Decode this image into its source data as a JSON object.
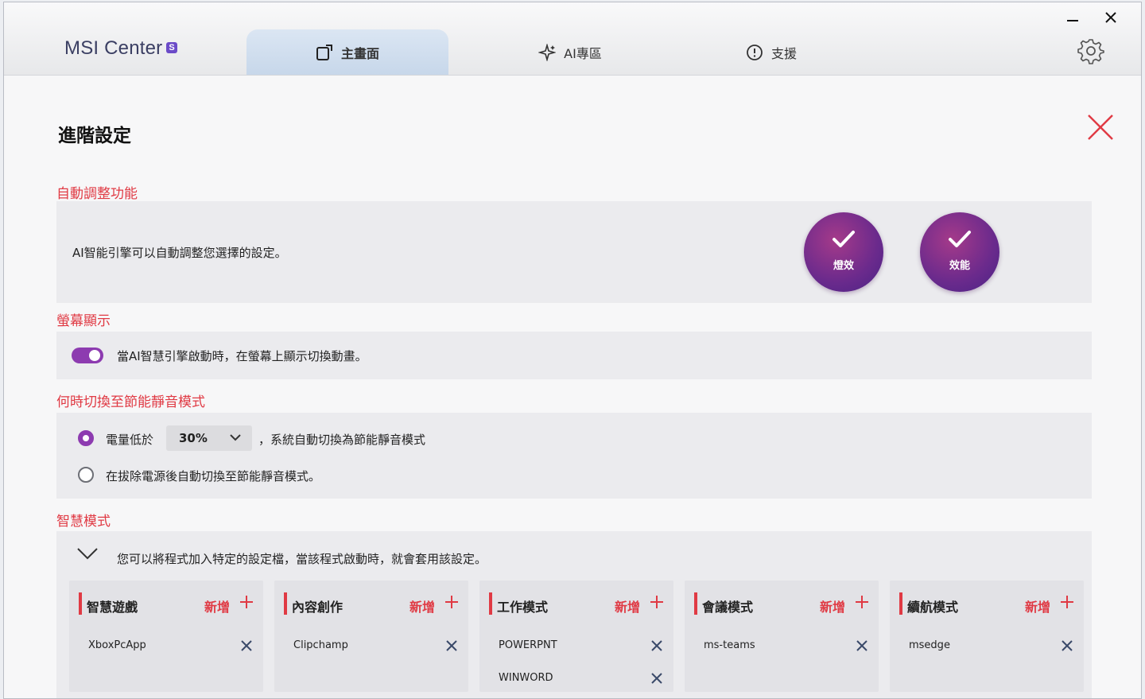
{
  "app": {
    "name": "MSI Center",
    "badge": "S"
  },
  "tabs": [
    {
      "label": "主畫面",
      "icon": "home-edit-icon",
      "active": true
    },
    {
      "label": "AI專區",
      "icon": "sparkle-icon",
      "active": false
    },
    {
      "label": "支援",
      "icon": "support-icon",
      "active": false
    }
  ],
  "page": {
    "title": "進階設定"
  },
  "auto_adjust": {
    "title": "自動調整功能",
    "description": "AI智能引擎可以自動調整您選擇的設定。",
    "options": [
      {
        "label": "燈效",
        "checked": true
      },
      {
        "label": "效能",
        "checked": true
      }
    ]
  },
  "screen_display": {
    "title": "螢幕顯示",
    "toggle_on": true,
    "text": "當AI智慧引擎啟動時，在螢幕上顯示切換動畫。"
  },
  "silent_mode": {
    "title": "何時切換至節能靜音模式",
    "option1_prefix": "電量低於",
    "option1_value": "30%",
    "option1_suffix": "，系統自動切換為節能靜音模式",
    "option2": "在拔除電源後自動切換至節能靜音模式。",
    "selected": 1
  },
  "smart_mode": {
    "title": "智慧模式",
    "description": "您可以將程式加入特定的設定檔，當該程式啟動時，就會套用該設定。",
    "add_label": "新增",
    "cards": [
      {
        "title": "智慧遊戲",
        "apps": [
          "XboxPcApp"
        ]
      },
      {
        "title": "內容創作",
        "apps": [
          "Clipchamp"
        ]
      },
      {
        "title": "工作模式",
        "apps": [
          "POWERPNT",
          "WINWORD"
        ]
      },
      {
        "title": "會議模式",
        "apps": [
          "ms-teams"
        ]
      },
      {
        "title": "續航模式",
        "apps": [
          "msedge"
        ]
      }
    ]
  },
  "colors": {
    "accent_red": "#e03a44",
    "accent_purple": "#8d3bb0"
  }
}
